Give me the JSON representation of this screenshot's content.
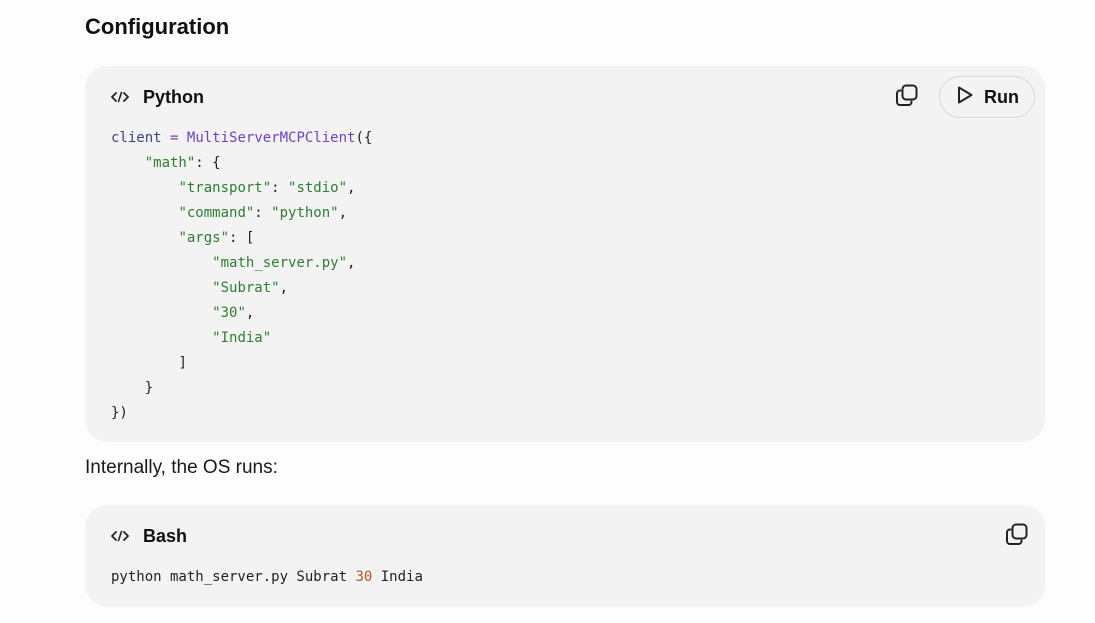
{
  "section": {
    "heading": "Configuration"
  },
  "python_block": {
    "language": "Python",
    "copy_icon": "copy-icon",
    "run_label": "Run",
    "run_icon": "play-icon",
    "code_lines": [
      [
        {
          "t": "client",
          "c": "var"
        },
        {
          "t": " ",
          "c": "plain"
        },
        {
          "t": "=",
          "c": "op"
        },
        {
          "t": " ",
          "c": "plain"
        },
        {
          "t": "MultiServerMCPClient",
          "c": "fn"
        },
        {
          "t": "({",
          "c": "punc"
        }
      ],
      [
        {
          "t": "    ",
          "c": "plain"
        },
        {
          "t": "\"math\"",
          "c": "str"
        },
        {
          "t": ": {",
          "c": "punc"
        }
      ],
      [
        {
          "t": "        ",
          "c": "plain"
        },
        {
          "t": "\"transport\"",
          "c": "str"
        },
        {
          "t": ": ",
          "c": "punc"
        },
        {
          "t": "\"stdio\"",
          "c": "str"
        },
        {
          "t": ",",
          "c": "punc"
        }
      ],
      [
        {
          "t": "        ",
          "c": "plain"
        },
        {
          "t": "\"command\"",
          "c": "str"
        },
        {
          "t": ": ",
          "c": "punc"
        },
        {
          "t": "\"python\"",
          "c": "str"
        },
        {
          "t": ",",
          "c": "punc"
        }
      ],
      [
        {
          "t": "        ",
          "c": "plain"
        },
        {
          "t": "\"args\"",
          "c": "str"
        },
        {
          "t": ": [",
          "c": "punc"
        }
      ],
      [
        {
          "t": "            ",
          "c": "plain"
        },
        {
          "t": "\"math_server.py\"",
          "c": "str"
        },
        {
          "t": ",",
          "c": "punc"
        }
      ],
      [
        {
          "t": "            ",
          "c": "plain"
        },
        {
          "t": "\"Subrat\"",
          "c": "str"
        },
        {
          "t": ",",
          "c": "punc"
        }
      ],
      [
        {
          "t": "            ",
          "c": "plain"
        },
        {
          "t": "\"30\"",
          "c": "str"
        },
        {
          "t": ",",
          "c": "punc"
        }
      ],
      [
        {
          "t": "            ",
          "c": "plain"
        },
        {
          "t": "\"India\"",
          "c": "str"
        }
      ],
      [
        {
          "t": "        ",
          "c": "plain"
        },
        {
          "t": "]",
          "c": "punc"
        }
      ],
      [
        {
          "t": "    ",
          "c": "plain"
        },
        {
          "t": "}",
          "c": "punc"
        }
      ],
      [
        {
          "t": "})",
          "c": "punc"
        }
      ]
    ]
  },
  "paragraph": {
    "text": "Internally, the OS runs:"
  },
  "bash_block": {
    "language": "Bash",
    "copy_icon": "copy-icon",
    "code_lines": [
      [
        {
          "t": "python math_server.py Subrat ",
          "c": "plain"
        },
        {
          "t": "30",
          "c": "num"
        },
        {
          "t": " India",
          "c": "plain"
        }
      ]
    ]
  },
  "colors": {
    "card_background": "#f3f3f3",
    "page_background": "#fdfdfd",
    "string": "#2e7d32",
    "number": "#b4532a",
    "function": "#6f42c1",
    "variable": "#3c3e8c"
  }
}
